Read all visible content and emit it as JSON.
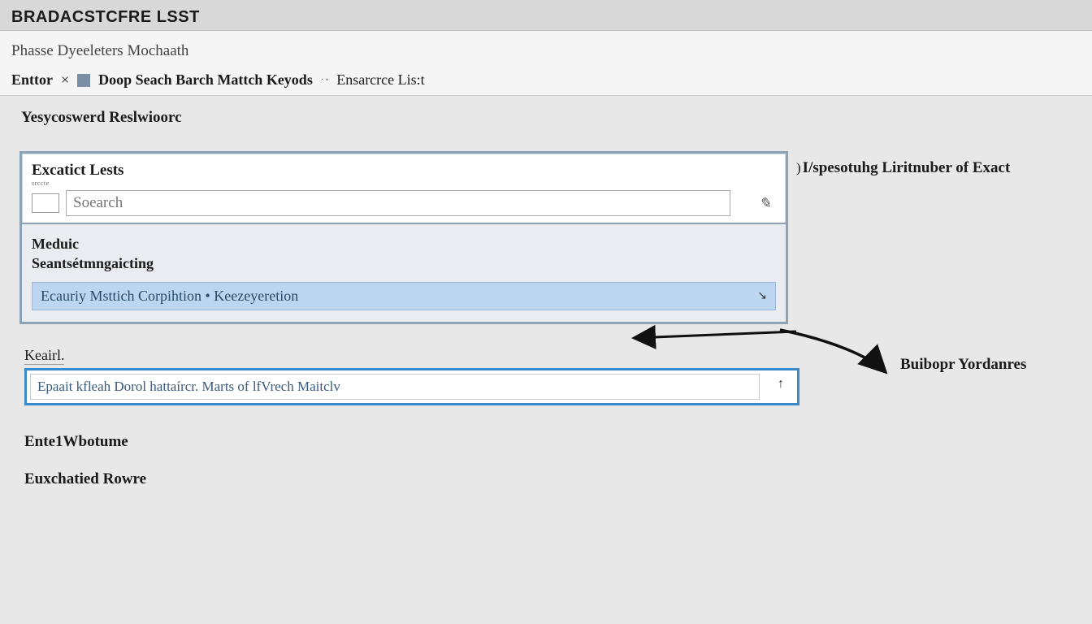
{
  "header": {
    "title": "BRADACSTCFRE LSST"
  },
  "subheader": {
    "line1": "Phasse Dyeeleters Mochaath",
    "entior_label": "Enttor",
    "bold_text": "Doop Seach Barch Mattch Keyods",
    "trailing": "Ensarcrce Lis:t"
  },
  "section_title": "Yesycoswerd Reslwioorc",
  "panel": {
    "top_title": "Excatict Lests",
    "tiny": "srccte",
    "search_placeholder": "Soearch",
    "mid_title_line1": "Meduic",
    "mid_title_line2": "Seantsétmngaicting",
    "highlight_text": "Ecauriy Msttich Corpihtion • Keezeyeretion"
  },
  "side_note": "I/spesotuhg Liritnuber of Exact",
  "side_label2": "Buibopr Yordanres",
  "lower": {
    "klabel": "Keairl.",
    "input_value": "Epaait kfleah Dorol hattaírcr. Marts of lfVrech Maitclv"
  },
  "footer": {
    "label1": "Ente1Wbotume",
    "label2": "Euxchatied Rowre"
  }
}
